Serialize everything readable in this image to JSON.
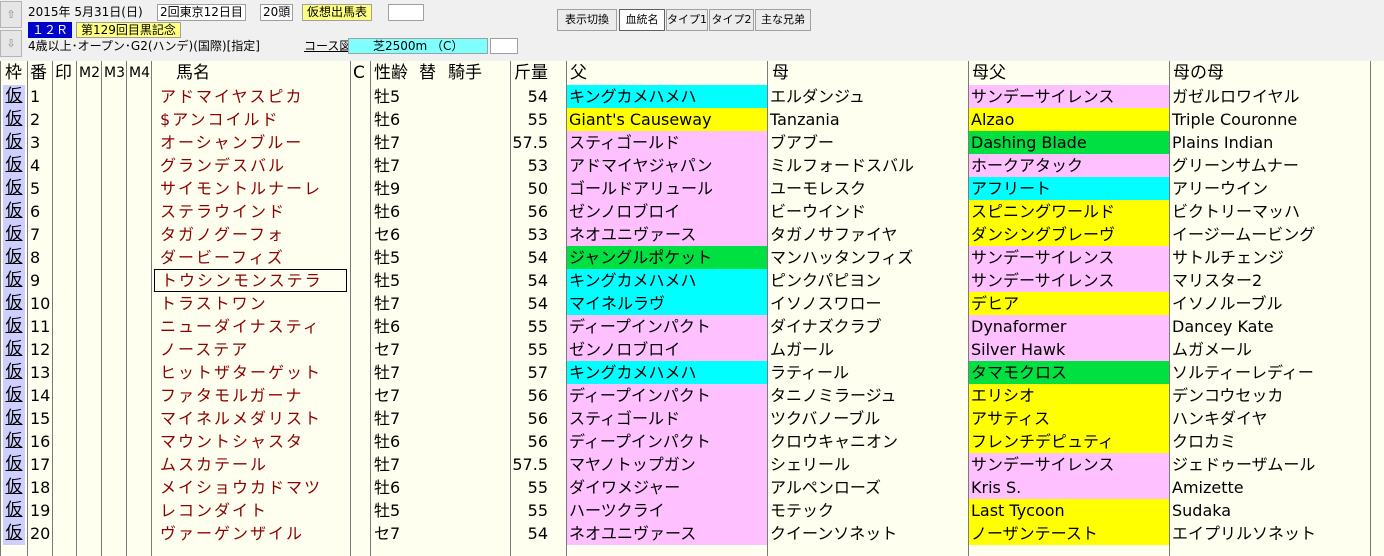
{
  "top": {
    "nav_up": "⇧",
    "nav_down": "⇩",
    "race_date": "2015年 5月31日(日)",
    "race_meet": "2回東京12日目",
    "field_size": "20頭",
    "card_button": "仮想出馬表",
    "race_no": "１２Ｒ",
    "race_name": "第129回目黒記念",
    "race_conditions": "4歳以上･オープン･G2(ハンデ)(国際)[指定]",
    "course_label": "コース図",
    "course_value": "芝2500m （C）",
    "toolbar": {
      "display_toggle": "表示切換",
      "pedigree": "血統名",
      "type1": "タイプ1",
      "type2": "タイプ2",
      "siblings": "主な兄弟"
    }
  },
  "header": {
    "waku": "枠",
    "ban": "番",
    "shirushi": "印",
    "m2": "M2",
    "m3": "M3",
    "m4": "M4",
    "horse": "馬名",
    "c": "C",
    "seirei": "性齢",
    "kae": "替",
    "jockey": "騎手",
    "kinryo": "斤量",
    "father": "父",
    "mother": "母",
    "mother_father": "母父",
    "mother_mother": "母の母"
  },
  "colors": {
    "cyan": "#00ffff",
    "yellow": "#ffff00",
    "pink": "#ffc0ff",
    "green": "#00e040",
    "horse_name": "#8b0000",
    "waku": "#cfcfff"
  },
  "rows": [
    {
      "waku": "仮",
      "num": "1",
      "horse": "アドマイヤスピカ",
      "sei": "牡5",
      "kin": "54",
      "f": "キングカメハメハ",
      "fc": "#00ffff",
      "m": "エルダンジュ",
      "mf": "サンデーサイレンス",
      "mfc": "#ffc0ff",
      "mm": "ガゼルロワイヤル"
    },
    {
      "waku": "仮",
      "num": "2",
      "horse": "$アンコイルド",
      "sei": "牡6",
      "kin": "55",
      "f": "Giant's Causeway",
      "fc": "#ffff00",
      "m": "Tanzania",
      "mf": "Alzao",
      "mfc": "#ffff00",
      "mm": "Triple Couronne"
    },
    {
      "waku": "仮",
      "num": "3",
      "horse": "オーシャンブルー",
      "sei": "牡7",
      "kin": "57.5",
      "f": "スティゴールド",
      "fc": "#ffc0ff",
      "m": "ブアブー",
      "mf": "Dashing Blade",
      "mfc": "#00e040",
      "mm": "Plains Indian"
    },
    {
      "waku": "仮",
      "num": "4",
      "horse": "グランデスバル",
      "sei": "牡7",
      "kin": "53",
      "f": "アドマイヤジャパン",
      "fc": "#ffc0ff",
      "m": "ミルフォードスバル",
      "mf": "ホークアタック",
      "mfc": "#ffc0ff",
      "mm": "グリーンサムナー"
    },
    {
      "waku": "仮",
      "num": "5",
      "horse": "サイモントルナーレ",
      "sei": "牡9",
      "kin": "50",
      "f": "ゴールドアリュール",
      "fc": "#ffc0ff",
      "m": "ユーモレスク",
      "mf": "アフリート",
      "mfc": "#00ffff",
      "mm": "アリーウイン"
    },
    {
      "waku": "仮",
      "num": "6",
      "horse": "ステラウインド",
      "sei": "牡6",
      "kin": "56",
      "f": "ゼンノロブロイ",
      "fc": "#ffc0ff",
      "m": "ビーウインド",
      "mf": "スピニングワールド",
      "mfc": "#ffff00",
      "mm": "ビクトリーマッハ"
    },
    {
      "waku": "仮",
      "num": "7",
      "horse": "タガノグーフォ",
      "sei": "セ6",
      "kin": "53",
      "f": "ネオユニヴァース",
      "fc": "#ffc0ff",
      "m": "タガノサファイヤ",
      "mf": "ダンシングブレーヴ",
      "mfc": "#ffff00",
      "mm": "イージームービング"
    },
    {
      "waku": "仮",
      "num": "8",
      "horse": "ダービーフィズ",
      "sei": "牡5",
      "kin": "54",
      "f": "ジャングルポケット",
      "fc": "#00e040",
      "m": "マンハッタンフィズ",
      "mf": "サンデーサイレンス",
      "mfc": "#ffc0ff",
      "mm": "サトルチェンジ"
    },
    {
      "waku": "仮",
      "num": "9",
      "horse": "トウシンモンステラ",
      "sei": "牡5",
      "kin": "54",
      "f": "キングカメハメハ",
      "fc": "#00ffff",
      "m": "ピンクパピヨン",
      "mf": "サンデーサイレンス",
      "mfc": "#ffc0ff",
      "mm": "マリスター2",
      "sel": true
    },
    {
      "waku": "仮",
      "num": "10",
      "horse": "トラストワン",
      "sei": "牡7",
      "kin": "54",
      "f": "マイネルラヴ",
      "fc": "#00ffff",
      "m": "イソノスワロー",
      "mf": "デヒア",
      "mfc": "#ffff00",
      "mm": "イソノルーブル"
    },
    {
      "waku": "仮",
      "num": "11",
      "horse": "ニューダイナスティ",
      "sei": "牡6",
      "kin": "55",
      "f": "ディープインパクト",
      "fc": "#ffc0ff",
      "m": "ダイナズクラブ",
      "mf": "Dynaformer",
      "mfc": "#ffc0ff",
      "mm": "Dancey Kate"
    },
    {
      "waku": "仮",
      "num": "12",
      "horse": "ノーステア",
      "sei": "セ7",
      "kin": "55",
      "f": "ゼンノロブロイ",
      "fc": "#ffc0ff",
      "m": "ムガール",
      "mf": "Silver Hawk",
      "mfc": "#ffc0ff",
      "mm": "ムガメール"
    },
    {
      "waku": "仮",
      "num": "13",
      "horse": "ヒットザターゲット",
      "sei": "牡7",
      "kin": "57",
      "f": "キングカメハメハ",
      "fc": "#00ffff",
      "m": "ラティール",
      "mf": "タマモクロス",
      "mfc": "#00e040",
      "mm": "ソルティーレディー"
    },
    {
      "waku": "仮",
      "num": "14",
      "horse": "ファタモルガーナ",
      "sei": "セ7",
      "kin": "56",
      "f": "ディープインパクト",
      "fc": "#ffc0ff",
      "m": "タニノミラージュ",
      "mf": "エリシオ",
      "mfc": "#ffff00",
      "mm": "デンコウセッカ"
    },
    {
      "waku": "仮",
      "num": "15",
      "horse": "マイネルメダリスト",
      "sei": "牡7",
      "kin": "56",
      "f": "スティゴールド",
      "fc": "#ffc0ff",
      "m": "ツクバノーブル",
      "mf": "アサティス",
      "mfc": "#ffff00",
      "mm": "ハンキダイヤ"
    },
    {
      "waku": "仮",
      "num": "16",
      "horse": "マウントシャスタ",
      "sei": "牡6",
      "kin": "56",
      "f": "ディープインパクト",
      "fc": "#ffc0ff",
      "m": "クロウキャニオン",
      "mf": "フレンチデピュティ",
      "mfc": "#ffff00",
      "mm": "クロカミ"
    },
    {
      "waku": "仮",
      "num": "17",
      "horse": "ムスカテール",
      "sei": "牡7",
      "kin": "57.5",
      "f": "マヤノトップガン",
      "fc": "#ffc0ff",
      "m": "シェリール",
      "mf": "サンデーサイレンス",
      "mfc": "#ffc0ff",
      "mm": "ジェドゥーザムール"
    },
    {
      "waku": "仮",
      "num": "18",
      "horse": "メイショウカドマツ",
      "sei": "牡6",
      "kin": "55",
      "f": "ダイワメジャー",
      "fc": "#ffc0ff",
      "m": "アルペンローズ",
      "mf": "Kris S.",
      "mfc": "#ffc0ff",
      "mm": "Amizette"
    },
    {
      "waku": "仮",
      "num": "19",
      "horse": "レコンダイト",
      "sei": "牡5",
      "kin": "55",
      "f": "ハーツクライ",
      "fc": "#ffc0ff",
      "m": "モテック",
      "mf": "Last Tycoon",
      "mfc": "#ffff00",
      "mm": "Sudaka"
    },
    {
      "waku": "仮",
      "num": "20",
      "horse": "ヴァーゲンザイル",
      "sei": "セ7",
      "kin": "54",
      "f": "ネオユニヴァース",
      "fc": "#ffc0ff",
      "m": "クイーンソネット",
      "mf": "ノーザンテースト",
      "mfc": "#ffff00",
      "mm": "エイプリルソネット"
    }
  ]
}
